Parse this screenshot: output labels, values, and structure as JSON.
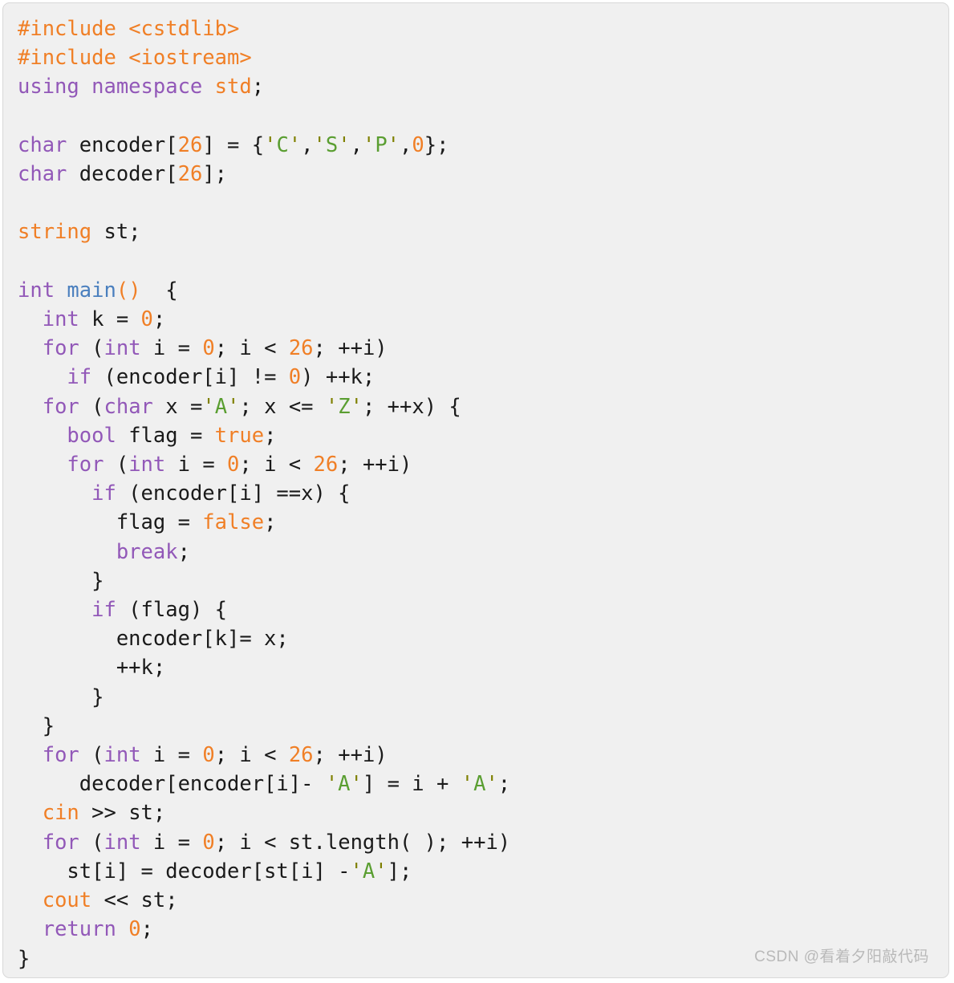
{
  "card": {
    "background_color": "#f0f0f0",
    "border_color": "#d8d8d8"
  },
  "theme": {
    "preprocessor_color": "#f07f26",
    "keyword_color": "#9258b8",
    "type_color": "#f07f26",
    "number_color": "#f07f26",
    "function_color": "#4a7fbe",
    "char_quote_color": "#7f8000",
    "char_value_color": "#5a9e31",
    "plain_color": "#1a1a1a",
    "watermark_color": "#b9b9b9"
  },
  "code": {
    "language": "C++",
    "plain_text": "#include <cstdlib>\n#include <iostream>\nusing namespace std;\n\nchar encoder[26] = {'C','S','P',0};\nchar decoder[26];\n\nstring st;\n\nint main()  {\n  int k = 0;\n  for (int i = 0; i < 26; ++i)\n    if (encoder[i] != 0) ++k;\n  for (char x ='A'; x <= 'Z'; ++x) {\n    bool flag = true;\n    for (int i = 0; i < 26; ++i)\n      if (encoder[i] ==x) {\n        flag = false;\n        break;\n      }\n      if (flag) {\n        encoder[k]= x;\n        ++k;\n      }\n  }\n  for (int i = 0; i < 26; ++i)\n     decoder[encoder[i]- 'A'] = i + 'A';\n  cin >> st;\n  for (int i = 0; i < st.length( ); ++i)\n    st[i] = decoder[st[i] -'A'];\n  cout << st;\n  return 0;\n}",
    "lines": [
      {
        "n": 1,
        "tokens": [
          {
            "t": "pre",
            "v": "#include"
          },
          {
            "t": "txt",
            "v": " "
          },
          {
            "t": "inc",
            "v": "<cstdlib>"
          }
        ]
      },
      {
        "n": 2,
        "tokens": [
          {
            "t": "pre",
            "v": "#include"
          },
          {
            "t": "txt",
            "v": " "
          },
          {
            "t": "inc",
            "v": "<iostream>"
          }
        ]
      },
      {
        "n": 3,
        "tokens": [
          {
            "t": "kw",
            "v": "using namespace"
          },
          {
            "t": "txt",
            "v": " "
          },
          {
            "t": "type",
            "v": "std"
          },
          {
            "t": "txt",
            "v": ";"
          }
        ]
      },
      {
        "n": 4,
        "tokens": []
      },
      {
        "n": 5,
        "tokens": [
          {
            "t": "kw",
            "v": "char"
          },
          {
            "t": "txt",
            "v": " encoder["
          },
          {
            "t": "num",
            "v": "26"
          },
          {
            "t": "txt",
            "v": "] = {"
          },
          {
            "t": "chr",
            "v": "'"
          },
          {
            "t": "chrv",
            "v": "C"
          },
          {
            "t": "chr",
            "v": "'"
          },
          {
            "t": "txt",
            "v": ","
          },
          {
            "t": "chr",
            "v": "'"
          },
          {
            "t": "chrv",
            "v": "S"
          },
          {
            "t": "chr",
            "v": "'"
          },
          {
            "t": "txt",
            "v": ","
          },
          {
            "t": "chr",
            "v": "'"
          },
          {
            "t": "chrv",
            "v": "P"
          },
          {
            "t": "chr",
            "v": "'"
          },
          {
            "t": "txt",
            "v": ","
          },
          {
            "t": "num",
            "v": "0"
          },
          {
            "t": "txt",
            "v": "};"
          }
        ]
      },
      {
        "n": 6,
        "tokens": [
          {
            "t": "kw",
            "v": "char"
          },
          {
            "t": "txt",
            "v": " decoder["
          },
          {
            "t": "num",
            "v": "26"
          },
          {
            "t": "txt",
            "v": "];"
          }
        ]
      },
      {
        "n": 7,
        "tokens": []
      },
      {
        "n": 8,
        "tokens": [
          {
            "t": "type",
            "v": "string"
          },
          {
            "t": "txt",
            "v": " st;"
          }
        ]
      },
      {
        "n": 9,
        "tokens": []
      },
      {
        "n": 10,
        "tokens": [
          {
            "t": "kw",
            "v": "int"
          },
          {
            "t": "txt",
            "v": " "
          },
          {
            "t": "fn",
            "v": "main"
          },
          {
            "t": "paren",
            "v": "()"
          },
          {
            "t": "txt",
            "v": "  {"
          }
        ]
      },
      {
        "n": 11,
        "tokens": [
          {
            "t": "txt",
            "v": "  "
          },
          {
            "t": "kw",
            "v": "int"
          },
          {
            "t": "txt",
            "v": " k = "
          },
          {
            "t": "num",
            "v": "0"
          },
          {
            "t": "txt",
            "v": ";"
          }
        ]
      },
      {
        "n": 12,
        "tokens": [
          {
            "t": "txt",
            "v": "  "
          },
          {
            "t": "kw",
            "v": "for"
          },
          {
            "t": "txt",
            "v": " ("
          },
          {
            "t": "kw",
            "v": "int"
          },
          {
            "t": "txt",
            "v": " i = "
          },
          {
            "t": "num",
            "v": "0"
          },
          {
            "t": "txt",
            "v": "; i < "
          },
          {
            "t": "num",
            "v": "26"
          },
          {
            "t": "txt",
            "v": "; ++i)"
          }
        ]
      },
      {
        "n": 13,
        "tokens": [
          {
            "t": "txt",
            "v": "    "
          },
          {
            "t": "kw",
            "v": "if"
          },
          {
            "t": "txt",
            "v": " (encoder[i] != "
          },
          {
            "t": "num",
            "v": "0"
          },
          {
            "t": "txt",
            "v": ") ++k;"
          }
        ]
      },
      {
        "n": 14,
        "tokens": [
          {
            "t": "txt",
            "v": "  "
          },
          {
            "t": "kw",
            "v": "for"
          },
          {
            "t": "txt",
            "v": " ("
          },
          {
            "t": "kw",
            "v": "char"
          },
          {
            "t": "txt",
            "v": " x ="
          },
          {
            "t": "chr",
            "v": "'"
          },
          {
            "t": "chrv",
            "v": "A"
          },
          {
            "t": "chr",
            "v": "'"
          },
          {
            "t": "txt",
            "v": "; x <= "
          },
          {
            "t": "chr",
            "v": "'"
          },
          {
            "t": "chrv",
            "v": "Z"
          },
          {
            "t": "chr",
            "v": "'"
          },
          {
            "t": "txt",
            "v": "; ++x) {"
          }
        ]
      },
      {
        "n": 15,
        "tokens": [
          {
            "t": "txt",
            "v": "    "
          },
          {
            "t": "kw",
            "v": "bool"
          },
          {
            "t": "txt",
            "v": " flag = "
          },
          {
            "t": "num",
            "v": "true"
          },
          {
            "t": "txt",
            "v": ";"
          }
        ]
      },
      {
        "n": 16,
        "tokens": [
          {
            "t": "txt",
            "v": "    "
          },
          {
            "t": "kw",
            "v": "for"
          },
          {
            "t": "txt",
            "v": " ("
          },
          {
            "t": "kw",
            "v": "int"
          },
          {
            "t": "txt",
            "v": " i = "
          },
          {
            "t": "num",
            "v": "0"
          },
          {
            "t": "txt",
            "v": "; i < "
          },
          {
            "t": "num",
            "v": "26"
          },
          {
            "t": "txt",
            "v": "; ++i)"
          }
        ]
      },
      {
        "n": 17,
        "tokens": [
          {
            "t": "txt",
            "v": "      "
          },
          {
            "t": "kw",
            "v": "if"
          },
          {
            "t": "txt",
            "v": " (encoder[i] ==x) {"
          }
        ]
      },
      {
        "n": 18,
        "tokens": [
          {
            "t": "txt",
            "v": "        flag = "
          },
          {
            "t": "num",
            "v": "false"
          },
          {
            "t": "txt",
            "v": ";"
          }
        ]
      },
      {
        "n": 19,
        "tokens": [
          {
            "t": "txt",
            "v": "        "
          },
          {
            "t": "kw",
            "v": "break"
          },
          {
            "t": "txt",
            "v": ";"
          }
        ]
      },
      {
        "n": 20,
        "tokens": [
          {
            "t": "txt",
            "v": "      }"
          }
        ]
      },
      {
        "n": 21,
        "tokens": [
          {
            "t": "txt",
            "v": "      "
          },
          {
            "t": "kw",
            "v": "if"
          },
          {
            "t": "txt",
            "v": " (flag) {"
          }
        ]
      },
      {
        "n": 22,
        "tokens": [
          {
            "t": "txt",
            "v": "        encoder[k]= x;"
          }
        ]
      },
      {
        "n": 23,
        "tokens": [
          {
            "t": "txt",
            "v": "        ++k;"
          }
        ]
      },
      {
        "n": 24,
        "tokens": [
          {
            "t": "txt",
            "v": "      }"
          }
        ]
      },
      {
        "n": 25,
        "tokens": [
          {
            "t": "txt",
            "v": "  }"
          }
        ]
      },
      {
        "n": 26,
        "tokens": [
          {
            "t": "txt",
            "v": "  "
          },
          {
            "t": "kw",
            "v": "for"
          },
          {
            "t": "txt",
            "v": " ("
          },
          {
            "t": "kw",
            "v": "int"
          },
          {
            "t": "txt",
            "v": " i = "
          },
          {
            "t": "num",
            "v": "0"
          },
          {
            "t": "txt",
            "v": "; i < "
          },
          {
            "t": "num",
            "v": "26"
          },
          {
            "t": "txt",
            "v": "; ++i)"
          }
        ]
      },
      {
        "n": 27,
        "tokens": [
          {
            "t": "txt",
            "v": "     decoder[encoder[i]- "
          },
          {
            "t": "chr",
            "v": "'"
          },
          {
            "t": "chrv",
            "v": "A"
          },
          {
            "t": "chr",
            "v": "'"
          },
          {
            "t": "txt",
            "v": "] = i + "
          },
          {
            "t": "chr",
            "v": "'"
          },
          {
            "t": "chrv",
            "v": "A"
          },
          {
            "t": "chr",
            "v": "'"
          },
          {
            "t": "txt",
            "v": ";"
          }
        ]
      },
      {
        "n": 28,
        "tokens": [
          {
            "t": "txt",
            "v": "  "
          },
          {
            "t": "type",
            "v": "cin"
          },
          {
            "t": "txt",
            "v": " >> st;"
          }
        ]
      },
      {
        "n": 29,
        "tokens": [
          {
            "t": "txt",
            "v": "  "
          },
          {
            "t": "kw",
            "v": "for"
          },
          {
            "t": "txt",
            "v": " ("
          },
          {
            "t": "kw",
            "v": "int"
          },
          {
            "t": "txt",
            "v": " i = "
          },
          {
            "t": "num",
            "v": "0"
          },
          {
            "t": "txt",
            "v": "; i < st.length( ); ++i)"
          }
        ]
      },
      {
        "n": 30,
        "tokens": [
          {
            "t": "txt",
            "v": "    st[i] = decoder[st[i] -"
          },
          {
            "t": "chr",
            "v": "'"
          },
          {
            "t": "chrv",
            "v": "A"
          },
          {
            "t": "chr",
            "v": "'"
          },
          {
            "t": "txt",
            "v": "];"
          }
        ]
      },
      {
        "n": 31,
        "tokens": [
          {
            "t": "txt",
            "v": "  "
          },
          {
            "t": "type",
            "v": "cout"
          },
          {
            "t": "txt",
            "v": " << st;"
          }
        ]
      },
      {
        "n": 32,
        "tokens": [
          {
            "t": "txt",
            "v": "  "
          },
          {
            "t": "kw",
            "v": "return"
          },
          {
            "t": "txt",
            "v": " "
          },
          {
            "t": "num",
            "v": "0"
          },
          {
            "t": "txt",
            "v": ";"
          }
        ]
      },
      {
        "n": 33,
        "tokens": [
          {
            "t": "txt",
            "v": "}"
          }
        ]
      }
    ]
  },
  "watermark": {
    "text": "CSDN @看着夕阳敲代码"
  }
}
